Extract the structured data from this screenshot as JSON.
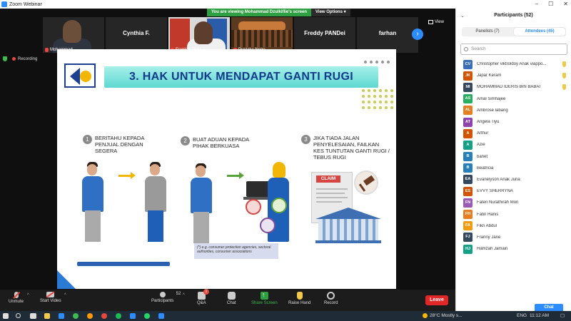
{
  "window": {
    "title": "Zoom Webinar"
  },
  "banner": {
    "viewing": "You are viewing Mohammad Dzulkiflie's screen",
    "view_options": "View Options ▾"
  },
  "thumbs": [
    {
      "name": "Mohammad ..."
    },
    {
      "name": "Cynthia F."
    },
    {
      "name": "Franklin PAN..."
    },
    {
      "name": "Pustaka Nege..."
    },
    {
      "name": "Freddy PANDei"
    },
    {
      "name": "farhan"
    }
  ],
  "view_button": {
    "label": "View"
  },
  "recording": {
    "label": "Recording"
  },
  "slide": {
    "title": "3. HAK UNTUK MENDAPAT GANTI RUGI",
    "steps": [
      {
        "num": "1",
        "text": "BERITAHU KEPADA PENJUAL DENGAN SEGERA"
      },
      {
        "num": "2",
        "text": "BUAT ADUAN KEPADA PIHAK BERKUASA"
      },
      {
        "num": "3",
        "text": "JIKA TIADA JALAN PENYELESAIAN, FAILKAN KES TUNTUTAN GANTI RUGI / TEBUS RUGI"
      }
    ],
    "claim_label": "CLAIM",
    "note": "(*) e.g. consumer protection agencies, sectoral authorities, consumer associations"
  },
  "controls": {
    "unmute": "Unmute",
    "start_video": "Start Video",
    "participants": "Participants",
    "participants_count": "52",
    "qa": "Q&A",
    "qa_badge": "1",
    "chat": "Chat",
    "share_screen": "Share Screen",
    "raise_hand": "Raise Hand",
    "record": "Record",
    "leave": "Leave"
  },
  "panel": {
    "title": "Participants (52)",
    "tabs": {
      "panelists": "Panelists (7)",
      "attendees": "Attendees (45)"
    },
    "search_placeholder": "Search",
    "chat_button": "Chat",
    "participants": [
      {
        "initials": "CV",
        "name": "Christopher viktroldoy Anak viappo...",
        "color": "#3b6fb6",
        "hand": true
      },
      {
        "initials": "JK",
        "name": "Japar Keram",
        "color": "#d35400",
        "hand": true
      },
      {
        "initials": "MI",
        "name": "MOHAMMAD IDERIS BIN BABAI",
        "color": "#34495e",
        "hand": true
      },
      {
        "initials": "AS",
        "name": "Amal Simhajee",
        "color": "#27ae60",
        "hand": false
      },
      {
        "initials": "AL",
        "name": "Ambrose labang",
        "color": "#e67e22",
        "hand": false
      },
      {
        "initials": "AT",
        "name": "Angela Tiyu",
        "color": "#8e44ad",
        "hand": false
      },
      {
        "initials": "A",
        "name": "Arthur",
        "color": "#d35400",
        "hand": false
      },
      {
        "initials": "A",
        "name": "Azie",
        "color": "#16a085",
        "hand": false
      },
      {
        "initials": "B",
        "name": "banet",
        "color": "#2980b9",
        "hand": false
      },
      {
        "initials": "B",
        "name": "Beatricia",
        "color": "#2980b9",
        "hand": false
      },
      {
        "initials": "EA",
        "name": "Evanelyson Anak Juna",
        "color": "#34495e",
        "hand": false
      },
      {
        "initials": "ES",
        "name": "EVVY SHERRYNA",
        "color": "#d35400",
        "hand": false
      },
      {
        "initials": "FN",
        "name": "Faten Nurathirah Mori",
        "color": "#9b59b6",
        "hand": false
      },
      {
        "initials": "FH",
        "name": "Fatin Hanis",
        "color": "#e67e22",
        "hand": false
      },
      {
        "initials": "FA",
        "name": "Fikri Abdul",
        "color": "#f39c12",
        "hand": false
      },
      {
        "initials": "FJ",
        "name": "Franny Jane",
        "color": "#34495e",
        "hand": false
      },
      {
        "initials": "HJ",
        "name": "Hamzah Jamain",
        "color": "#16a085",
        "hand": false
      }
    ]
  },
  "taskbar": {
    "weather": "28°C  Mostly s...",
    "lang": "ENG",
    "time": "11:12 AM"
  }
}
